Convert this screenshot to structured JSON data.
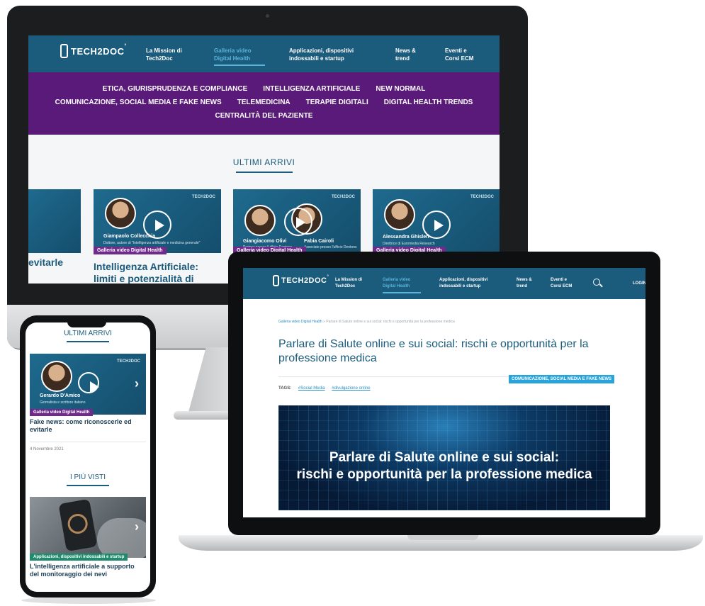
{
  "brand": {
    "name": "TECH2DOC",
    "tm": "°"
  },
  "desktop": {
    "nav": [
      {
        "label": "La Mission di Tech2Doc",
        "active": false
      },
      {
        "label": "Galleria video Digital Health",
        "active": true
      },
      {
        "label": "Applicazioni, dispositivi indossabili e startup",
        "active": false
      },
      {
        "label": "News & trend",
        "active": false
      },
      {
        "label": "Eventi e Corsi ECM",
        "active": false
      }
    ],
    "categories_row1": [
      "ETICA, GIURISPRUDENZA E COMPLIANCE",
      "INTELLIGENZA ARTIFICIALE",
      "NEW NORMAL"
    ],
    "categories_row2": [
      "COMUNICAZIONE, SOCIAL MEDIA E FAKE NEWS",
      "TELEMEDICINA",
      "TERAPIE DIGITALI",
      "DIGITAL HEALTH TRENDS"
    ],
    "categories_row3": [
      "CENTRALITÀ DEL PAZIENTE"
    ],
    "section_title": "ULTIMI ARRIVI",
    "cards": [
      {
        "person": "",
        "role": "",
        "tag": "",
        "title_line1": "",
        "title_line2": "evitarle"
      },
      {
        "person": "Giampaolo Collecchia",
        "role": "Dottore, autore di \"Intelligenza artificiale e medicina generale\"",
        "tag": "Galleria video Digital Health",
        "title_line1": "Intelligenza Artificiale:",
        "title_line2": "limiti e potenzialità di"
      },
      {
        "person": "Giangiacomo Olivi",
        "person2": "Fabia Cairoli",
        "role": "Partner presso l'ufficio Dentons",
        "role2": "Associate presso l'ufficio Dentons",
        "tag": "Galleria video Digital Health",
        "title_line1": "",
        "title_line2": ""
      },
      {
        "person": "Alessandra Ghisleri",
        "role": "Direttrice di Euromedia Research",
        "tag": "Galleria video Digital Health",
        "title_line1": "",
        "title_line2": ""
      }
    ],
    "thumb_brand": "TECH2DOC"
  },
  "laptop": {
    "nav": [
      {
        "label": "La Mission di Tech2Doc",
        "active": false
      },
      {
        "label": "Galleria video Digital Health",
        "active": true
      },
      {
        "label": "Applicazioni, dispositivi indossabili e startup",
        "active": false
      },
      {
        "label": "News & trend",
        "active": false
      },
      {
        "label": "Eventi e Corsi ECM",
        "active": false
      }
    ],
    "login": "LOGIN",
    "breadcrumb_link": "Galleria video Digital Health",
    "breadcrumb_sep": " » ",
    "breadcrumb_current": "Parlare di Salute online e sui social: rischi e opportunità per la professione medica",
    "article_title": "Parlare di Salute online e sui social: rischi e opportunità per la professione medica",
    "category_badge": "COMUNICAZIONE, SOCIAL MEDIA E FAKE NEWS",
    "tags_label": "TAGS:",
    "tags": [
      "#Social Media",
      "#divulgazione online"
    ],
    "hero_line1": "Parlare di Salute online e sui social:",
    "hero_line2": "rischi e opportunità per la professione medica"
  },
  "phone": {
    "section_title": "ULTIMI ARRIVI",
    "card1": {
      "person": "Gerardo D'Amico",
      "role": "Giornalista e scrittore italiano",
      "tag": "Galleria video Digital Health",
      "title": "Fake news: come riconoscerle ed evitarle"
    },
    "date": "4 Novembre 2021",
    "section2_title": "I PIÙ VISTI",
    "card2": {
      "tag": "Applicazioni, dispositivi indossabili e startup",
      "title": "L'intelligenza artificiale a supporto del monitoraggio dei nevi"
    },
    "thumb_brand": "TECH2DOC"
  },
  "colors": {
    "nav": "#1b5b7c",
    "category_bar": "#5a1a7a",
    "accent": "#29a3dc",
    "tag_purple": "#6f2a8c",
    "tag_green": "#1f8a6c"
  }
}
